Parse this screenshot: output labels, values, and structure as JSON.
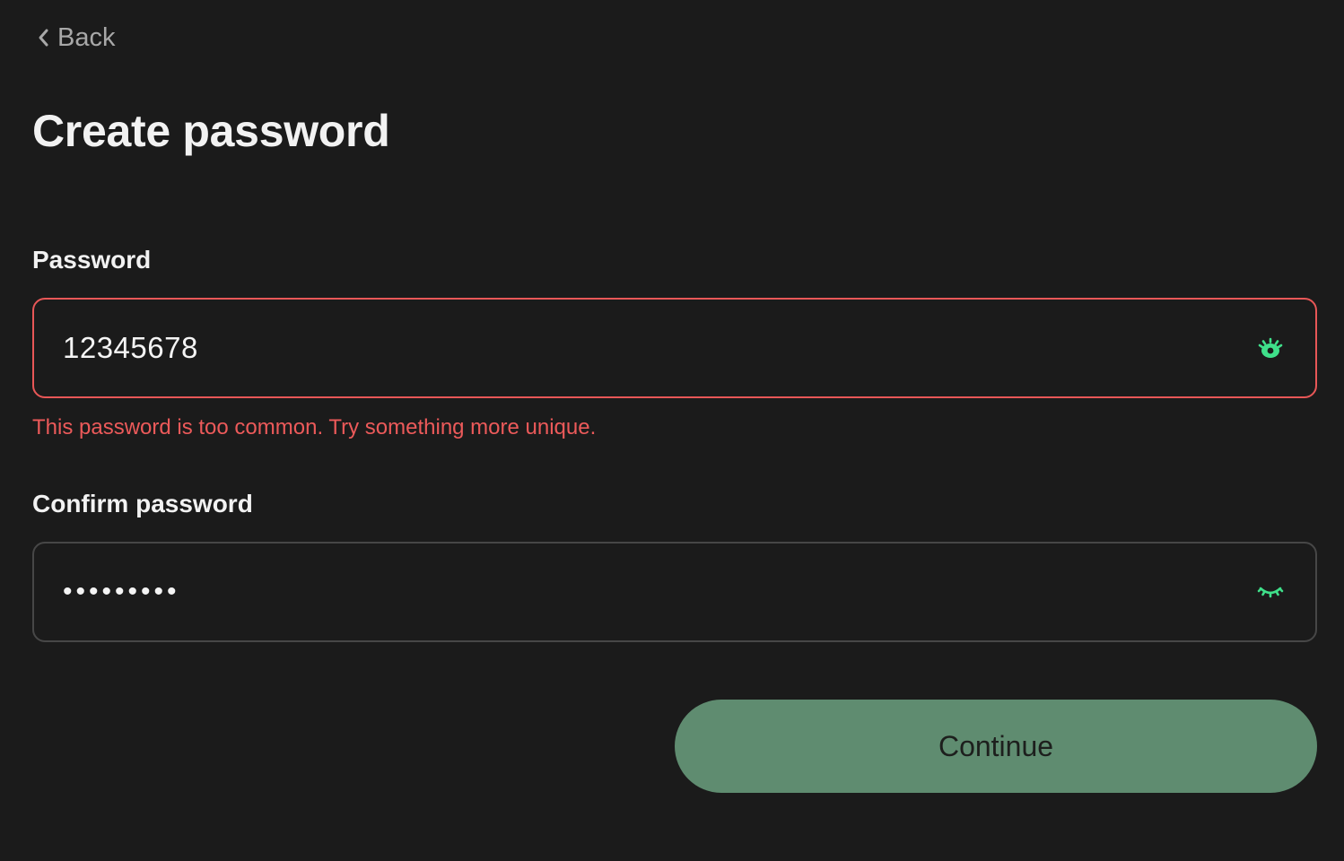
{
  "nav": {
    "back_label": "Back",
    "back_icon": "chevron-left-icon"
  },
  "page": {
    "title": "Create password"
  },
  "password_field": {
    "label": "Password",
    "value": "12345678",
    "visibility": "shown",
    "toggle_icon": "eye-open-icon",
    "error": "This password is too common. Try something more unique.",
    "border_color": "#e85757"
  },
  "confirm_field": {
    "label": "Confirm password",
    "value": "•••••••••",
    "visibility": "hidden",
    "toggle_icon": "eye-closed-icon",
    "border_color": "#474747"
  },
  "actions": {
    "continue_label": "Continue",
    "continue_color": "#5f8c70"
  },
  "colors": {
    "background": "#1b1b1b",
    "accent_icon": "#3fe08a",
    "error": "#ec5a5a"
  }
}
